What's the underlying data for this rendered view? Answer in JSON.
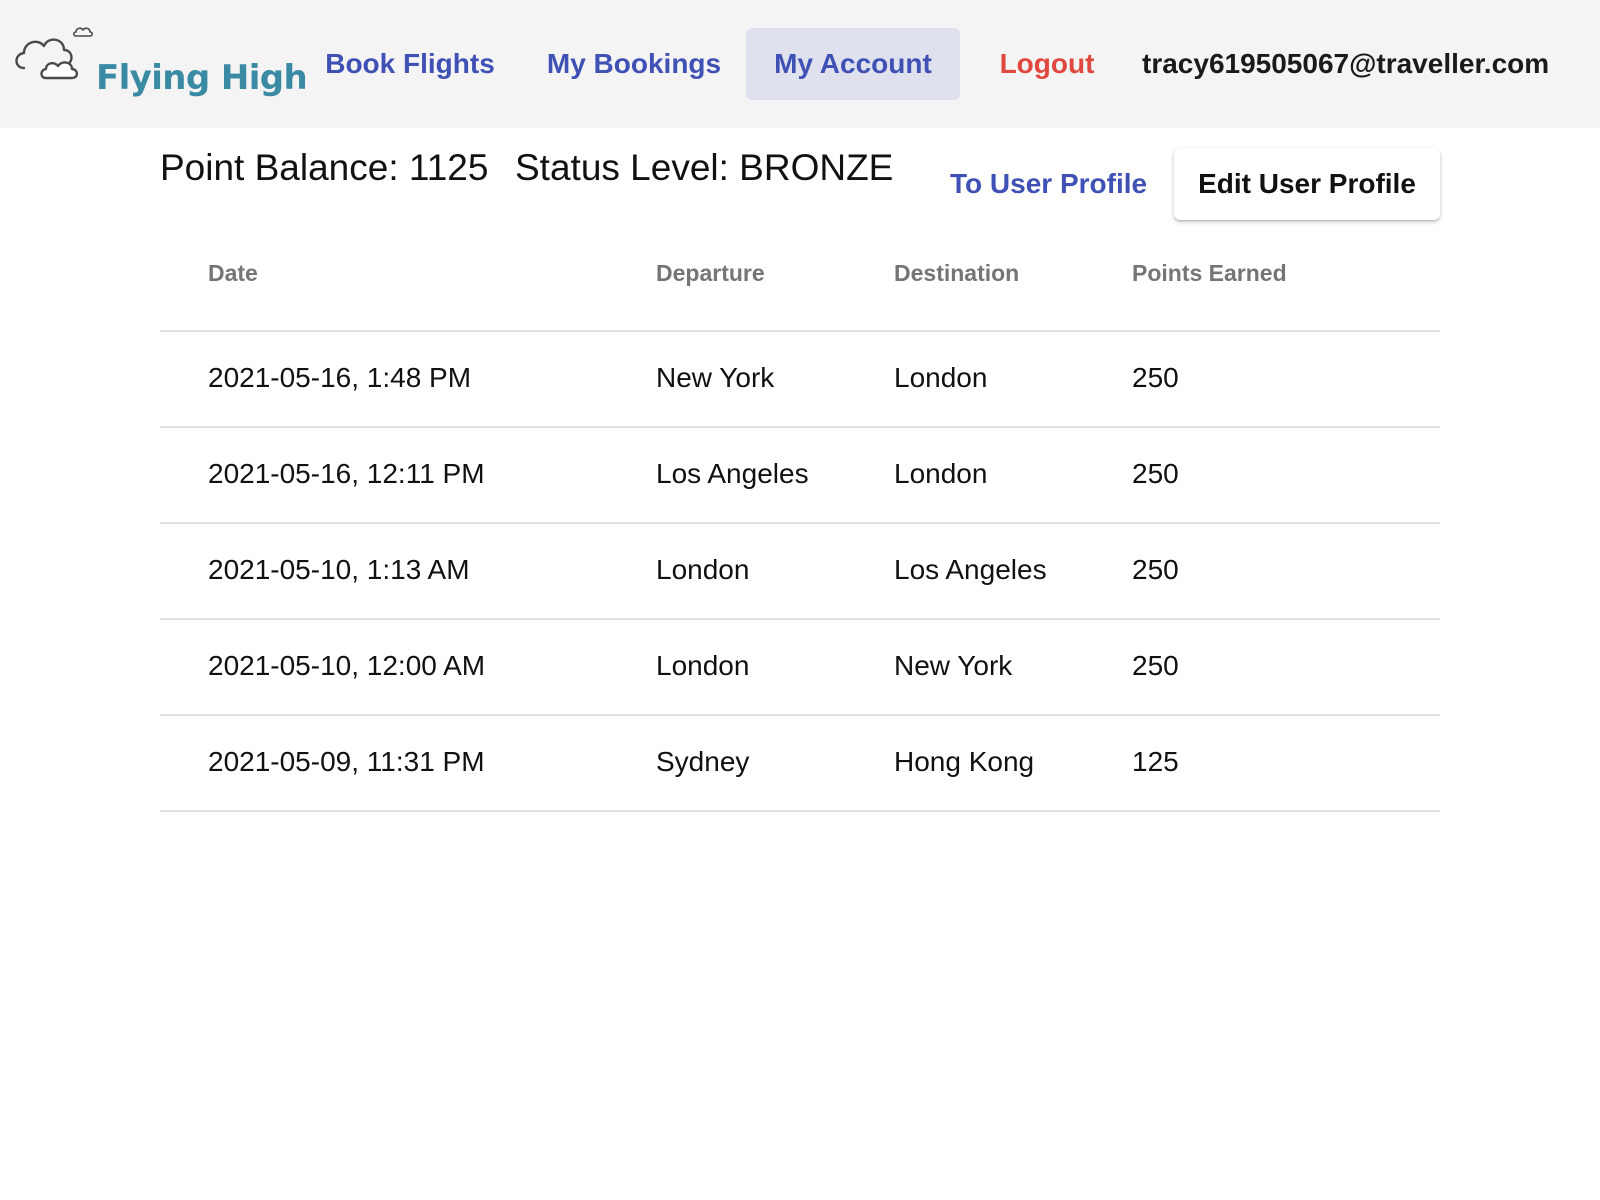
{
  "app": {
    "brand": "Flying High"
  },
  "nav": {
    "book_flights": "Book Flights",
    "my_bookings": "My Bookings",
    "my_account": "My Account",
    "logout": "Logout",
    "user_email": "tracy619505067@traveller.com",
    "active": "My Account"
  },
  "account": {
    "point_balance": "Point Balance: 1125",
    "status_level": "Status Level: BRONZE",
    "to_user_profile": "To User Profile",
    "edit_user_profile": "Edit User Profile"
  },
  "table": {
    "columns": [
      "Date",
      "Departure",
      "Destination",
      "Points Earned"
    ],
    "rows": [
      {
        "date": "2021-05-16, 1:48 PM",
        "departure": "New York",
        "destination": "London",
        "points": "250"
      },
      {
        "date": "2021-05-16, 12:11 PM",
        "departure": "Los Angeles",
        "destination": "London",
        "points": "250"
      },
      {
        "date": "2021-05-10, 1:13 AM",
        "departure": "London",
        "destination": "Los Angeles",
        "points": "250"
      },
      {
        "date": "2021-05-10, 12:00 AM",
        "departure": "London",
        "destination": "New York",
        "points": "250"
      },
      {
        "date": "2021-05-09, 11:31 PM",
        "departure": "Sydney",
        "destination": "Hong Kong",
        "points": "125"
      }
    ]
  },
  "colors": {
    "header_bg": "#f4f4f4",
    "nav_link": "#3f51b5",
    "nav_active_bg": "#dfe1ee",
    "logout": "#e0483e",
    "brand": "#3b8aa4",
    "table_header_text": "#757575",
    "divider": "#e0e0e0"
  },
  "icons": {
    "logo": "clouds-logo-icon"
  }
}
